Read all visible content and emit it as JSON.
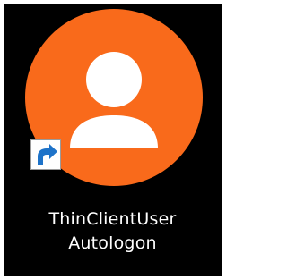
{
  "desktop_icon": {
    "label_line_1": "ThinClientUser",
    "label_line_2": "Autologon",
    "icon_name": "user-avatar-icon",
    "overlay_icon_name": "shortcut-arrow-icon",
    "colors": {
      "avatar_background": "#f96a1b",
      "avatar_figure": "#ffffff",
      "desktop_background": "#000000",
      "label_text": "#ffffff",
      "shortcut_arrow": "#1e73c9"
    }
  }
}
